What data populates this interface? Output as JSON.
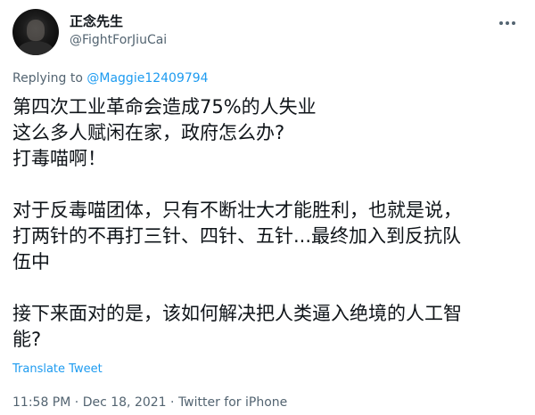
{
  "author": {
    "display_name": "正念先生",
    "handle": "@FightForJiuCai"
  },
  "reply": {
    "prefix": "Replying to ",
    "target": "@Maggie12409794"
  },
  "content": {
    "paragraph_1": "第四次工业革命会造成75%的人失业\n这么多人赋闲在家，政府怎么办?\n打毒喵啊！",
    "paragraph_2": "对于反毒喵团体，只有不断壮大才能胜利，也就是说，\n打两针的不再打三针、四针、五针...最终加入到反抗队\n伍中",
    "paragraph_3": "接下来面对的是，该如何解决把人类逼入绝境的人工智\n能?"
  },
  "translate_label": "Translate Tweet",
  "meta": {
    "time": "11:58 PM",
    "separator": " · ",
    "date": "Dec 18, 2021",
    "client": "Twitter for iPhone"
  },
  "icons": {
    "more": "more-horizontal-icon"
  },
  "colors": {
    "link": "#1d9bf0",
    "secondary": "#536471",
    "text": "#0f1419"
  }
}
